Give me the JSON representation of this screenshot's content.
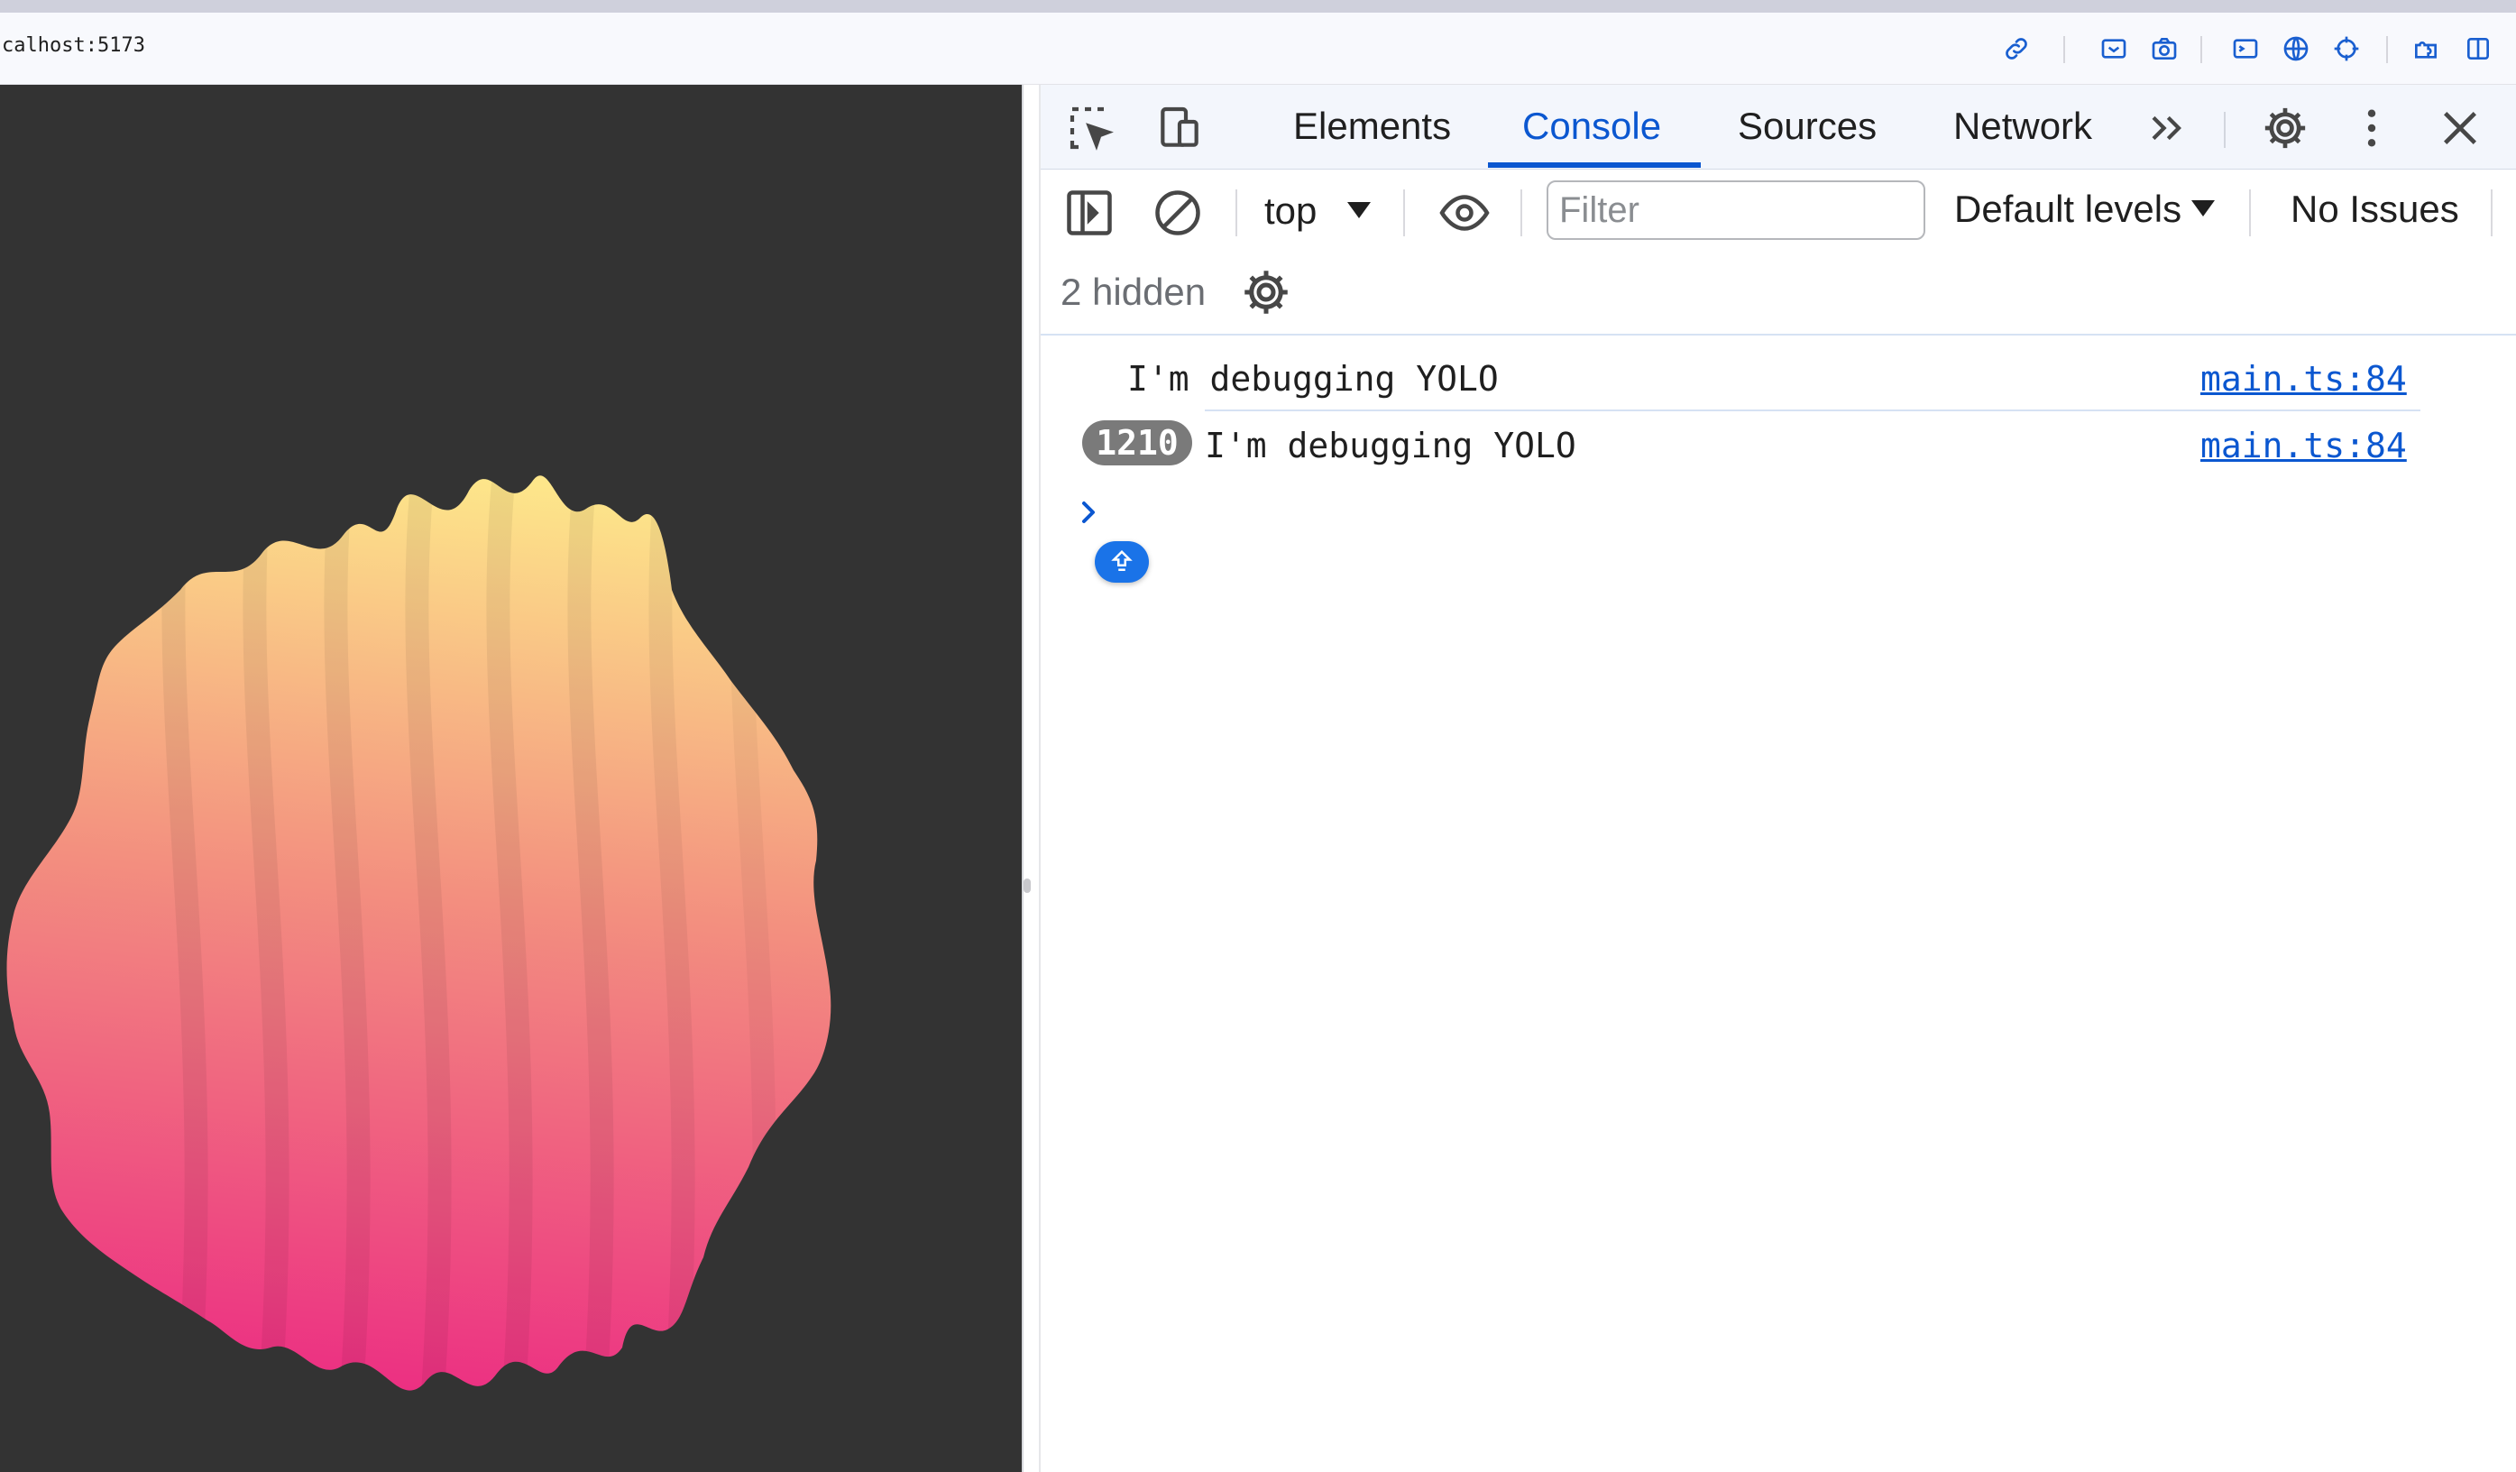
{
  "browser": {
    "url": "calhost:5173",
    "address_icons": [
      "link-icon",
      "screen-capture-icon",
      "camera-icon",
      "terminal-icon",
      "globe-icon",
      "crosshair-icon",
      "extensions-icon",
      "sidebar-icon"
    ]
  },
  "page": {
    "background": "#333333",
    "blob_colors": [
      "#fde68a",
      "#f3907f",
      "#ec2f82"
    ]
  },
  "devtools": {
    "tabs": [
      {
        "label": "Elements",
        "active": false
      },
      {
        "label": "Console",
        "active": true
      },
      {
        "label": "Sources",
        "active": false
      },
      {
        "label": "Network",
        "active": false
      }
    ],
    "toolbar": {
      "context": "top",
      "filter_placeholder": "Filter",
      "levels": "Default levels",
      "issues": "No Issues"
    },
    "hidden_text": "2 hidden",
    "messages": [
      {
        "text": "I'm debugging YOLO",
        "source": "main.ts:84",
        "count": ""
      },
      {
        "text": "I'm debugging YOLO",
        "source": "main.ts:84",
        "count": "1210"
      }
    ],
    "accent": "#0b57d0"
  }
}
